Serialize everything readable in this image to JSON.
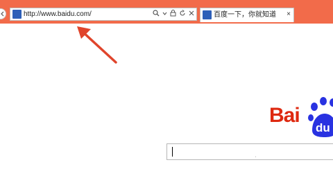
{
  "browser": {
    "address_url": "http://www.baidu.com/",
    "tab_title": "百度一下，你就知道",
    "tab_close": "×"
  },
  "page": {
    "logo_text": "Bai",
    "logo_paw_text": "du"
  },
  "icons": [
    "back-icon",
    "site-icon",
    "search-icon",
    "dropdown-icon",
    "lock-icon",
    "refresh-icon",
    "close-icon",
    "baidu-paw-icon",
    "arrow-annotation"
  ],
  "colors": {
    "top_bar": "#f26b4a",
    "baidu_red": "#de2910",
    "baidu_blue": "#2932e1",
    "arrow": "#e0452c"
  }
}
